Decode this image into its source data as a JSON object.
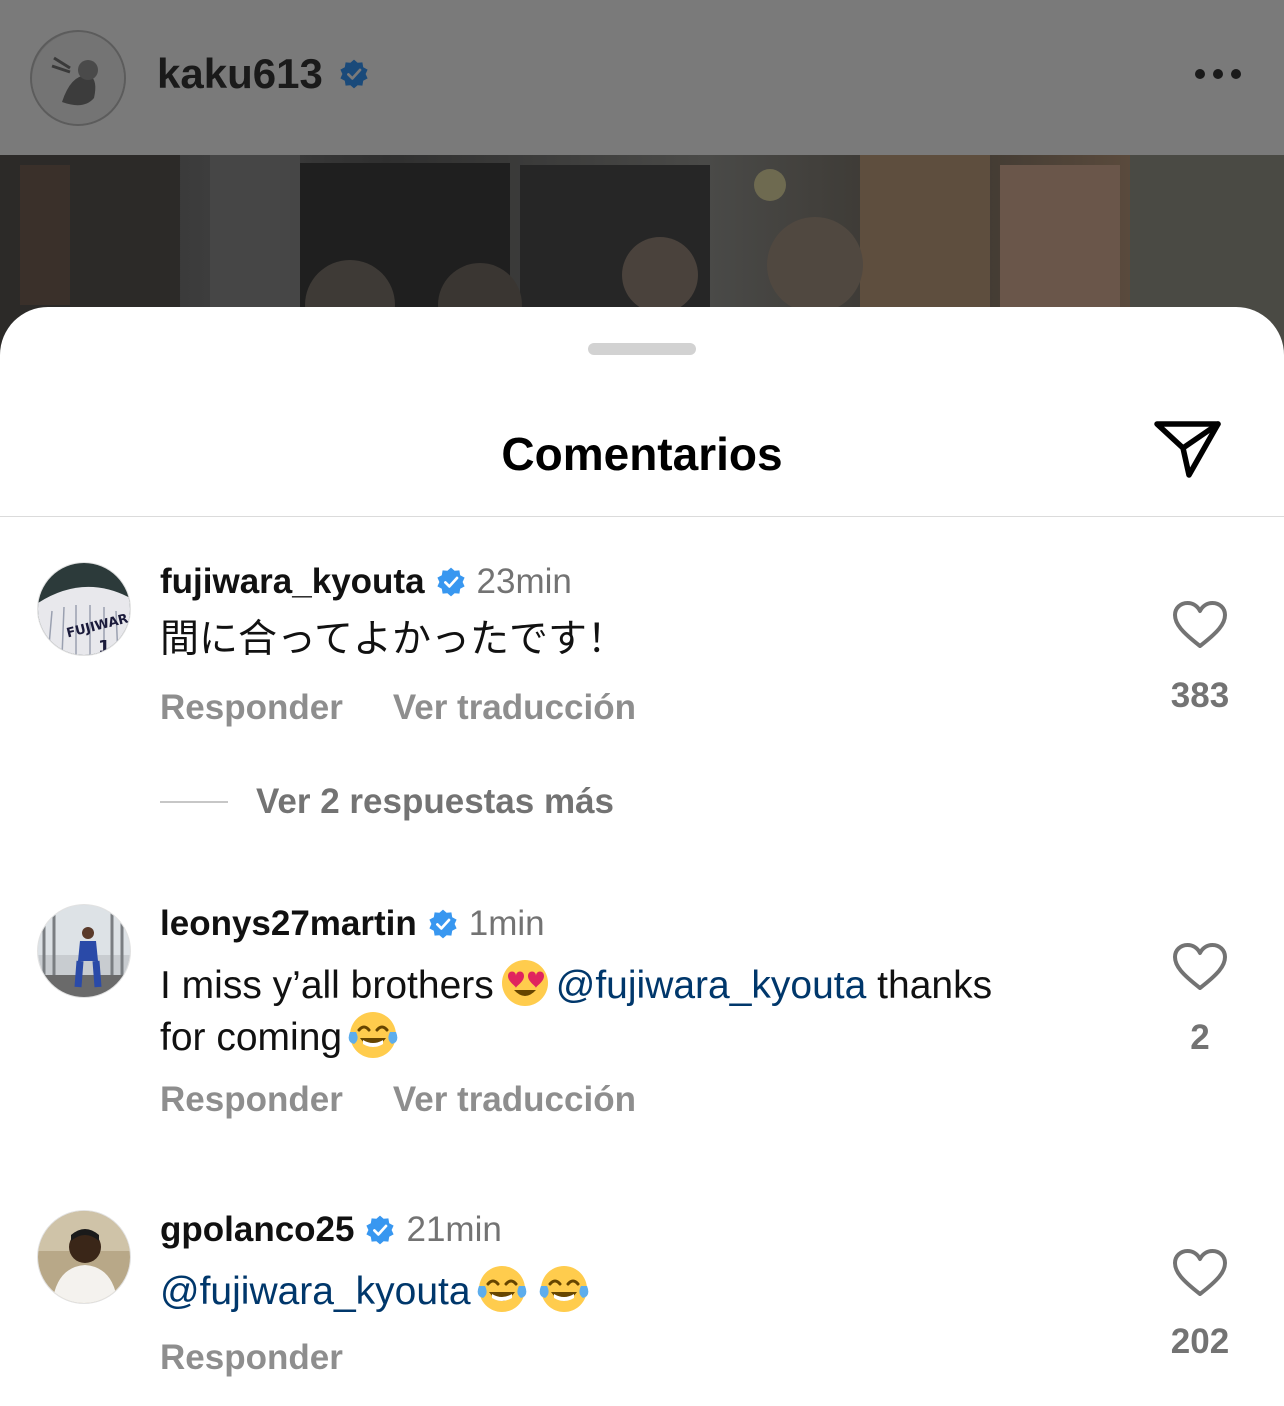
{
  "post": {
    "username": "kaku613",
    "verified_icon": "verified-badge-icon",
    "more_icon": "more-horizontal-icon"
  },
  "sheet": {
    "title": "Comentarios",
    "share_icon": "send-paper-plane-icon"
  },
  "comments": [
    {
      "username": "fujiwara_kyouta",
      "time": "23min",
      "text": "間に合ってよかったです！",
      "reply_label": "Responder",
      "translate_label": "Ver traducción",
      "likes": "383",
      "view_replies": "Ver 2 respuestas más"
    },
    {
      "username": "leonys27martin",
      "time": "1min",
      "text_part1": "I miss y’all brothers",
      "emoji1": "heart-eyes-emoji",
      "mention": "@fujiwara_kyouta",
      "text_part2": "thanks",
      "text_part3": "for coming",
      "emoji2": "tears-of-joy-emoji",
      "reply_label": "Responder",
      "translate_label": "Ver traducción",
      "likes": "2"
    },
    {
      "username": "gpolanco25",
      "time": "21min",
      "mention": "@fujiwara_kyouta",
      "emoji": "tears-of-joy-emoji",
      "reply_label": "Responder",
      "likes": "202"
    }
  ],
  "colors": {
    "verified_blue": "#3897f0",
    "mention_blue": "#00376b",
    "secondary_text": "#737373",
    "heart_emoji_face": "#ffcc4d"
  }
}
